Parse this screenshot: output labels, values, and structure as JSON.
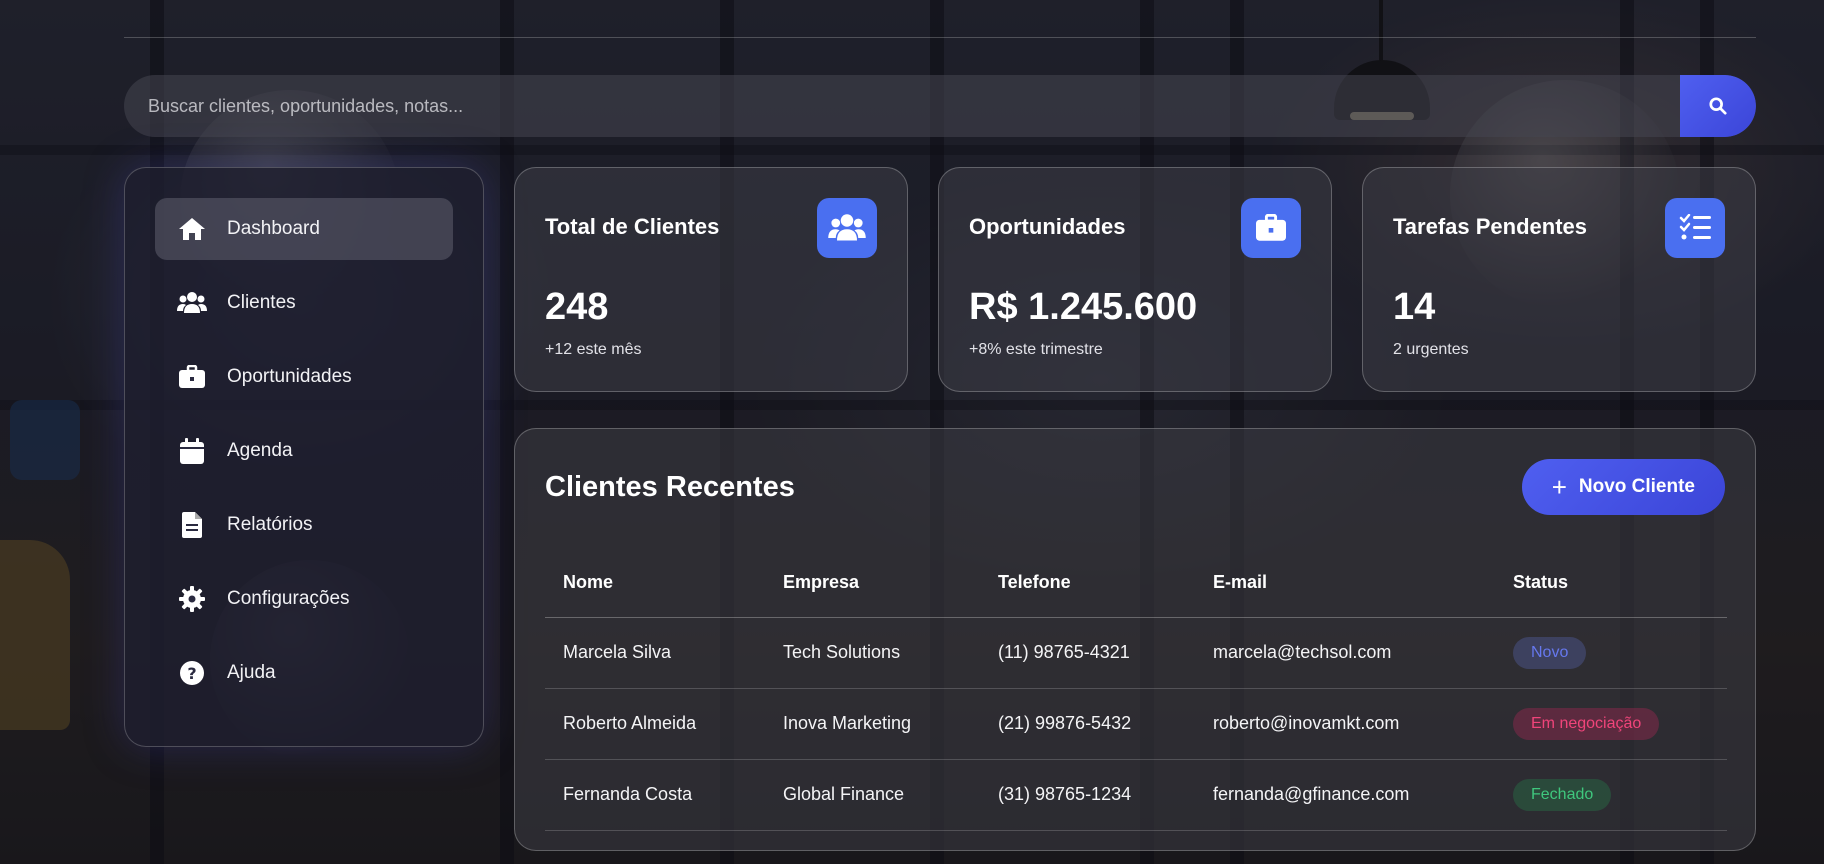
{
  "search": {
    "placeholder": "Buscar clientes, oportunidades, notas...",
    "button_icon": "search-icon"
  },
  "sidebar": {
    "items": [
      {
        "label": "Dashboard",
        "icon": "home-icon",
        "active": true
      },
      {
        "label": "Clientes",
        "icon": "users-icon",
        "active": false
      },
      {
        "label": "Oportunidades",
        "icon": "briefcase-icon",
        "active": false
      },
      {
        "label": "Agenda",
        "icon": "calendar-icon",
        "active": false
      },
      {
        "label": "Relatórios",
        "icon": "file-icon",
        "active": false
      },
      {
        "label": "Configurações",
        "icon": "gear-icon",
        "active": false
      },
      {
        "label": "Ajuda",
        "icon": "question-icon",
        "active": false
      }
    ]
  },
  "stats": [
    {
      "title": "Total de Clientes",
      "value": "248",
      "sub": "+12 este mês",
      "icon": "users-icon"
    },
    {
      "title": "Oportunidades",
      "value": "R$ 1.245.600",
      "sub": "+8% este trimestre",
      "icon": "briefcase-icon"
    },
    {
      "title": "Tarefas Pendentes",
      "value": "14",
      "sub": "2 urgentes",
      "icon": "tasks-icon"
    }
  ],
  "recent": {
    "title": "Clientes Recentes",
    "new_button": "Novo Cliente",
    "columns": [
      "Nome",
      "Empresa",
      "Telefone",
      "E-mail",
      "Status"
    ],
    "rows": [
      {
        "nome": "Marcela Silva",
        "empresa": "Tech Solutions",
        "telefone": "(11) 98765-4321",
        "email": "marcela@techsol.com",
        "status": "Novo"
      },
      {
        "nome": "Roberto Almeida",
        "empresa": "Inova Marketing",
        "telefone": "(21) 99876-5432",
        "email": "roberto@inovamkt.com",
        "status": "Em negociação"
      },
      {
        "nome": "Fernanda Costa",
        "empresa": "Global Finance",
        "telefone": "(31) 98765-1234",
        "email": "fernanda@gfinance.com",
        "status": "Fechado"
      }
    ]
  },
  "colors": {
    "accent": "#4f5ff0",
    "icon_box": "#4a6ff0",
    "status_novo": "#6678ee",
    "status_negociacao": "#f0447a",
    "status_fechado": "#3fc77d"
  }
}
